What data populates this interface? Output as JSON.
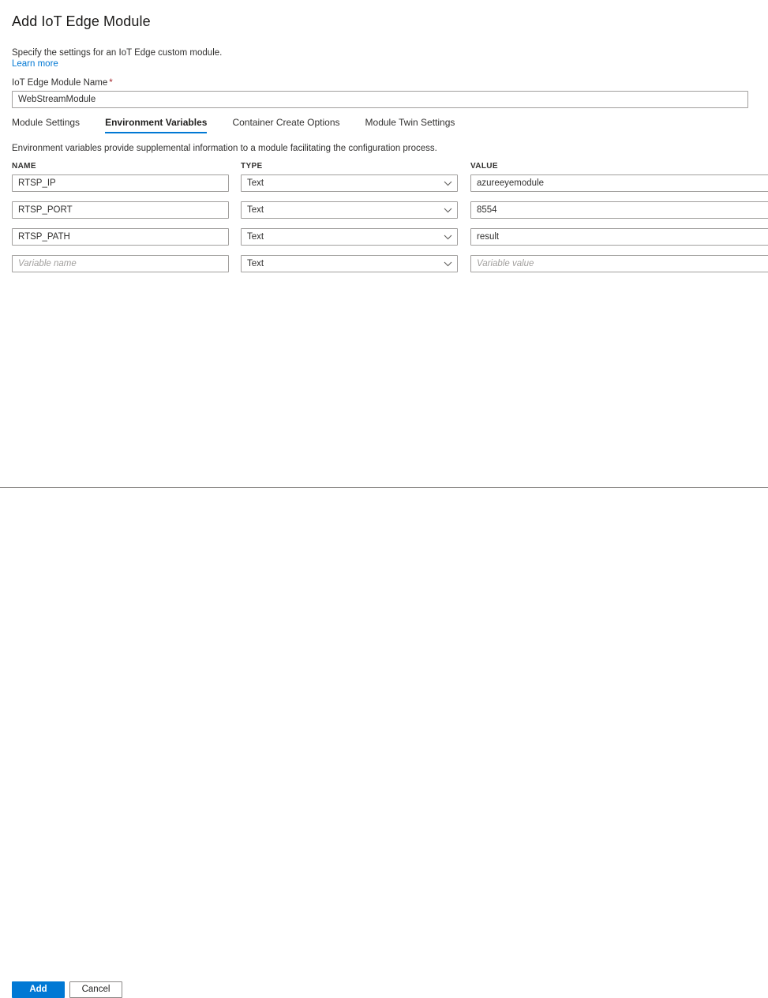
{
  "blade": {
    "title": "Add IoT Edge Module",
    "intro": "Specify the settings for an IoT Edge custom module.",
    "learn_more": "Learn more",
    "module_name_label": "IoT Edge Module Name",
    "required_marker": "*",
    "module_name_value": "WebStreamModule"
  },
  "tabs": [
    {
      "label": "Module Settings",
      "active": false
    },
    {
      "label": "Environment Variables",
      "active": true
    },
    {
      "label": "Container Create Options",
      "active": false
    },
    {
      "label": "Module Twin Settings",
      "active": false
    }
  ],
  "env_vars": {
    "description": "Environment variables provide supplemental information to a module facilitating the configuration process.",
    "columns": {
      "name": "NAME",
      "type": "TYPE",
      "value": "VALUE"
    },
    "type_options": [
      "Text"
    ],
    "placeholders": {
      "name": "Variable name",
      "value": "Variable value"
    },
    "rows": [
      {
        "name": "RTSP_IP",
        "type": "Text",
        "value": "azureeyemodule"
      },
      {
        "name": "RTSP_PORT",
        "type": "Text",
        "value": "8554"
      },
      {
        "name": "RTSP_PATH",
        "type": "Text",
        "value": "result"
      },
      {
        "name": "",
        "type": "Text",
        "value": ""
      }
    ]
  },
  "footer": {
    "add_label": "Add",
    "cancel_label": "Cancel"
  },
  "colors": {
    "accent": "#0078d4",
    "required": "#a4262c",
    "text": "#323130",
    "border": "#a19f9d",
    "separator": "#8a8886"
  }
}
